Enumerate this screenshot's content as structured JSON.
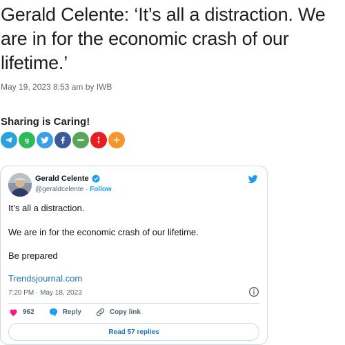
{
  "article": {
    "headline": "Gerald Celente: ‘It’s all a distraction. We are in for the economic crash of our lifetime.’",
    "meta": "May 19, 2023 8:53 am by IWB"
  },
  "sharing": {
    "title": "Sharing is Caring!",
    "buttons": [
      {
        "name": "telegram",
        "color": "#2aa3dc"
      },
      {
        "name": "gab",
        "color": "#2fba5a"
      },
      {
        "name": "twitter",
        "color": "#3a9fe6"
      },
      {
        "name": "facebook",
        "color": "#3b5a9a"
      },
      {
        "name": "email",
        "color": "#58a55c"
      },
      {
        "name": "gettr",
        "color": "#e81c24"
      },
      {
        "name": "more",
        "color": "#f4962c"
      }
    ]
  },
  "tweet": {
    "author_name": "Gerald Celente",
    "handle": "@geraldcelente",
    "separator": " · ",
    "follow_label": "Follow",
    "lines": [
      "It’s all a distraction.",
      "We are in for the economic crash of our lifetime.",
      "Be prepared"
    ],
    "link_text": "Trendsjournal.com",
    "timestamp": "7:20 PM · May 18, 2023",
    "likes": "962",
    "reply_label": "Reply",
    "copy_link_label": "Copy link",
    "read_replies_label": "Read 57 replies"
  }
}
